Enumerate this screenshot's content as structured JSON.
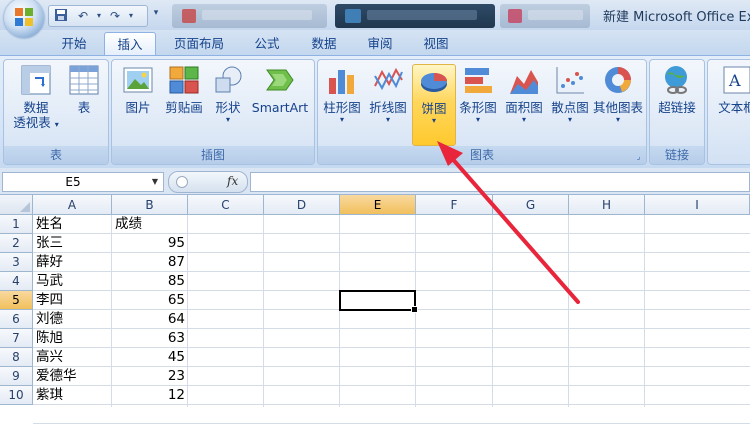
{
  "title_bar": {
    "app_title": "新建 Microsoft Office Ex"
  },
  "ribbon_tabs": [
    {
      "label": "开始"
    },
    {
      "label": "插入",
      "active": true
    },
    {
      "label": "页面布局"
    },
    {
      "label": "公式"
    },
    {
      "label": "数据"
    },
    {
      "label": "审阅"
    },
    {
      "label": "视图"
    }
  ],
  "ribbon": {
    "groups": {
      "tables": {
        "label": "表",
        "pivot_line1": "数据",
        "pivot_line2": "透视表",
        "table": "表"
      },
      "illustrations": {
        "label": "插图",
        "picture": "图片",
        "clipart": "剪贴画",
        "shapes": "形状",
        "smartart": "SmartArt"
      },
      "charts": {
        "label": "图表",
        "column": "柱形图",
        "line": "折线图",
        "pie": "饼图",
        "bar": "条形图",
        "area": "面积图",
        "scatter": "散点图",
        "other": "其他图表"
      },
      "links": {
        "label": "链接",
        "hyperlink": "超链接"
      },
      "text": {
        "textbox": "文本框"
      }
    }
  },
  "formula_bar": {
    "name_box": "E5",
    "fx_label": "fx",
    "formula_value": ""
  },
  "sheet": {
    "columns": [
      "A",
      "B",
      "C",
      "D",
      "E",
      "F",
      "G",
      "H",
      "I"
    ],
    "rows": [
      "1",
      "2",
      "3",
      "4",
      "5",
      "6",
      "7",
      "8",
      "9",
      "10"
    ],
    "selected_column": "E",
    "selected_row": "5",
    "cells": [
      {
        "name": "姓名",
        "score": "成绩"
      },
      {
        "name": "张三",
        "score": "95"
      },
      {
        "name": "薛好",
        "score": "87"
      },
      {
        "name": "马武",
        "score": "85"
      },
      {
        "name": "李四",
        "score": "65"
      },
      {
        "name": "刘德",
        "score": "64"
      },
      {
        "name": "陈旭",
        "score": "63"
      },
      {
        "name": "高兴",
        "score": "45"
      },
      {
        "name": "爱德华",
        "score": "23"
      },
      {
        "name": "紫琪",
        "score": "12"
      }
    ]
  },
  "colors": {
    "annotation_arrow": "#e8253a",
    "ribbon_text": "#15428b",
    "selected_highlight": "#ffd75e"
  }
}
